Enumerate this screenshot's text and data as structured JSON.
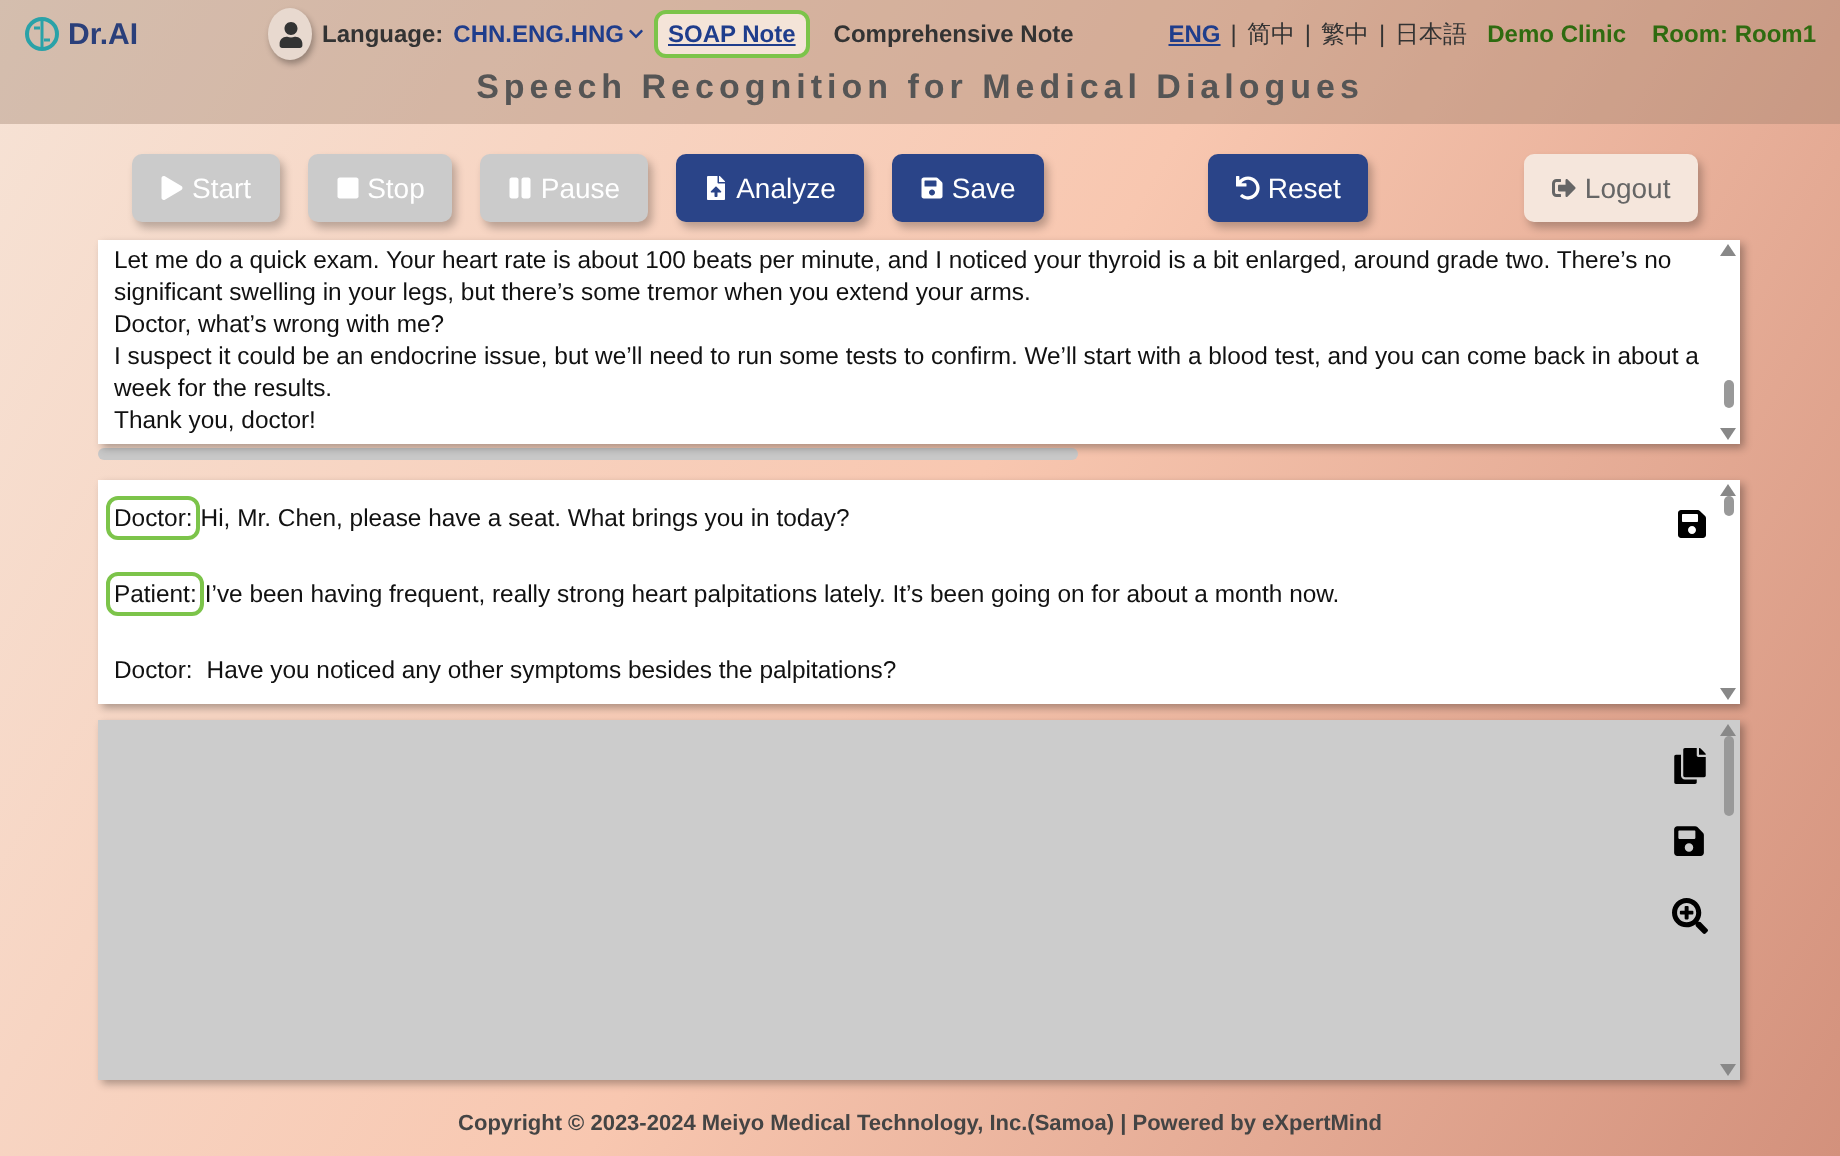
{
  "brand": {
    "name": "Dr.AI"
  },
  "language": {
    "label": "Language:",
    "value": "CHN.ENG.HNG"
  },
  "note_tabs": [
    {
      "label": "SOAP Note",
      "selected": true
    },
    {
      "label": "Comprehensive Note",
      "selected": false
    }
  ],
  "ui_languages": [
    {
      "label": "ENG",
      "selected": true
    },
    {
      "label": "简中",
      "selected": false
    },
    {
      "label": "繁中",
      "selected": false
    },
    {
      "label": "日本語",
      "selected": false
    }
  ],
  "language_separator": "|",
  "clinic": "Demo Clinic",
  "room": "Room: Room1",
  "title": "Speech Recognition for Medical Dialogues",
  "buttons": [
    {
      "label": "Start",
      "kind": "start",
      "disabled": true
    },
    {
      "label": "Stop",
      "kind": "stop",
      "disabled": true
    },
    {
      "label": "Pause",
      "kind": "pause",
      "disabled": true
    },
    {
      "label": "Analyze",
      "kind": "analyze",
      "disabled": false
    },
    {
      "label": "Save",
      "kind": "save",
      "disabled": false
    },
    {
      "label": "Reset",
      "kind": "reset",
      "disabled": false
    },
    {
      "label": "Logout",
      "kind": "logout",
      "disabled": false
    }
  ],
  "transcript_lines": [
    "Let me do a quick exam. Your heart rate is about 100 beats per minute, and I noticed your thyroid is a bit enlarged, around grade two. There’s no significant swelling in your legs, but there’s some tremor when you extend your arms.",
    "Doctor, what’s wrong with me?",
    "I suspect it could be an endocrine issue, but we’ll need to run some tests to confirm. We’ll start with a blood test, and you can come back in about a week for the results.",
    "Thank you, doctor!"
  ],
  "dialogue": [
    {
      "speaker": "Doctor:",
      "text": "Hi, Mr. Chen, please have a seat. What brings you in today?",
      "highlighted": true
    },
    {
      "speaker": "Patient:",
      "text": "I’ve been having frequent, really strong heart palpitations lately. It’s been going on for about a month now.",
      "highlighted": true
    },
    {
      "speaker": "Doctor:",
      "text": "Have you noticed any other symptoms besides the palpitations?",
      "highlighted": false
    }
  ],
  "footer": "Copyright © 2023-2024 Meiyo Medical Technology, Inc.(Samoa) | Powered by eXpertMind"
}
